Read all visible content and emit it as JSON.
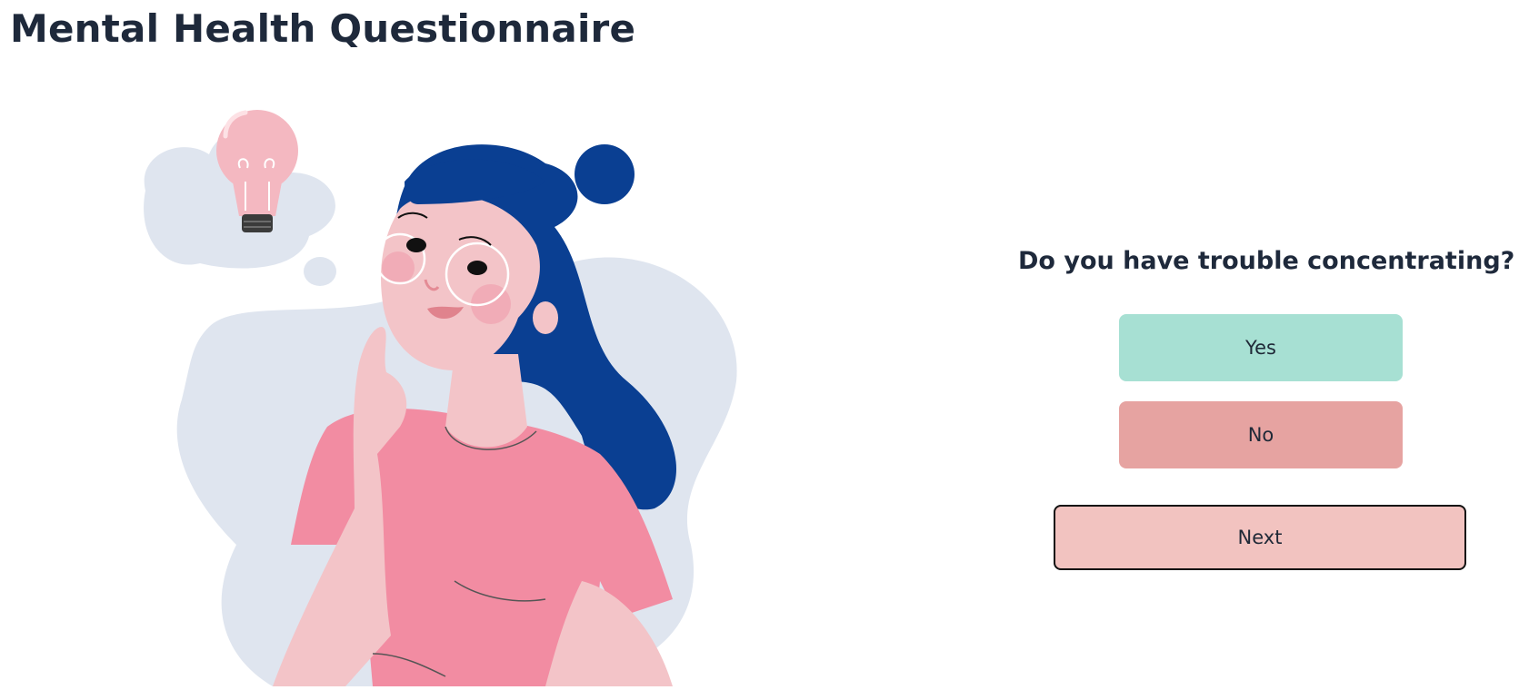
{
  "page": {
    "title": "Mental Health Questionnaire"
  },
  "question": {
    "text": "Do you have trouble concentrating?",
    "options": [
      "Yes",
      "No"
    ]
  },
  "actions": {
    "next_label": "Next"
  },
  "colors": {
    "yes_button": "#a7e0d3",
    "no_button": "#e6a3a1",
    "next_button": "#f2c3c0",
    "title_text": "#1e293b"
  },
  "illustration": {
    "icon": "woman-thinking-lightbulb-illustration"
  }
}
